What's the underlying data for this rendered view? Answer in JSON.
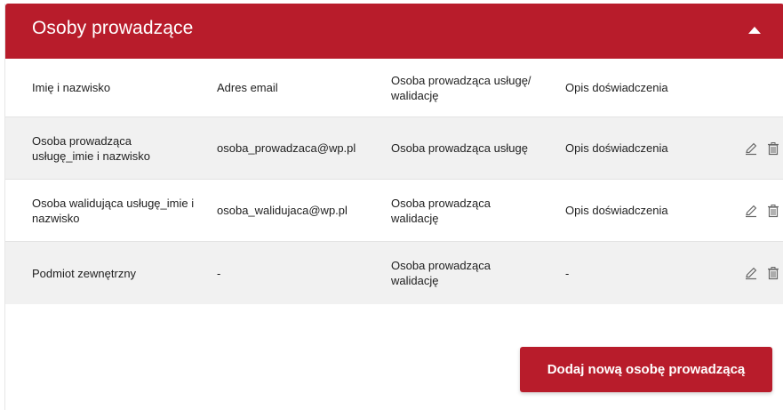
{
  "panel": {
    "title": "Osoby prowadzące",
    "accent_color": "#b81c2b",
    "collapse_icon": "chevron-up-icon"
  },
  "table": {
    "columns": [
      "Imię i nazwisko",
      "Adres email",
      "Osoba prowadząca usługę/ walidację",
      "Opis doświadczenia"
    ],
    "rows": [
      {
        "name": "Osoba prowadząca usługę_imie i nazwisko",
        "email": "osoba_prowadzaca@wp.pl",
        "role": "Osoba prowadząca usługę",
        "experience": "Opis doświadczenia"
      },
      {
        "name": "Osoba walidująca usługę_imie i nazwisko",
        "email": "osoba_walidujaca@wp.pl",
        "role": "Osoba prowadząca walidację",
        "experience": "Opis doświadczenia"
      },
      {
        "name": "Podmiot zewnętrzny",
        "email": "-",
        "role": "Osoba prowadząca walidację",
        "experience": "-"
      }
    ],
    "row_actions": [
      "edit-icon",
      "delete-icon"
    ]
  },
  "actions": {
    "add_label": "Dodaj nową osobę prowadzącą"
  }
}
